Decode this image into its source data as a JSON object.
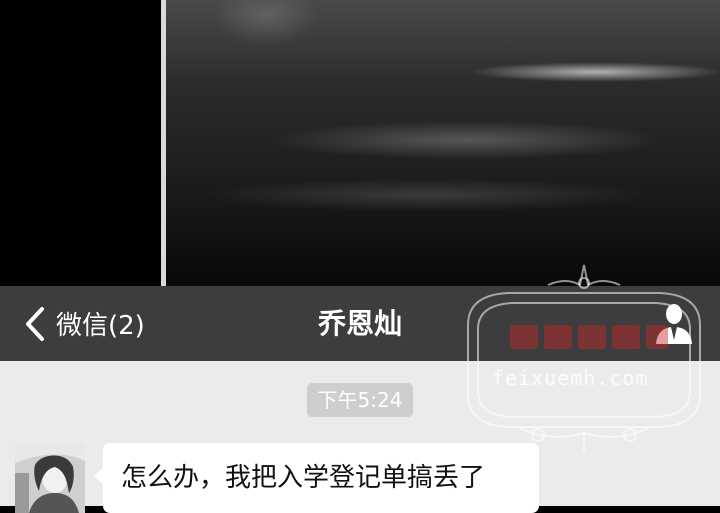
{
  "nav": {
    "back_label": "微信(2)",
    "title": "乔恩灿",
    "icons": {
      "back": "chevron-left-icon",
      "profile": "person-icon"
    }
  },
  "chat": {
    "timestamp": "下午5:24",
    "messages": [
      {
        "sender": "contact",
        "text": "怎么办，我把入学登记单搞丢了"
      }
    ]
  },
  "watermark": {
    "url": "feixuemh.com"
  },
  "colors": {
    "navbar_bg": "#3d3d3f",
    "chat_bg": "#ebebeb",
    "timestamp_bg": "#cecece",
    "bubble_bg": "#ffffff"
  }
}
